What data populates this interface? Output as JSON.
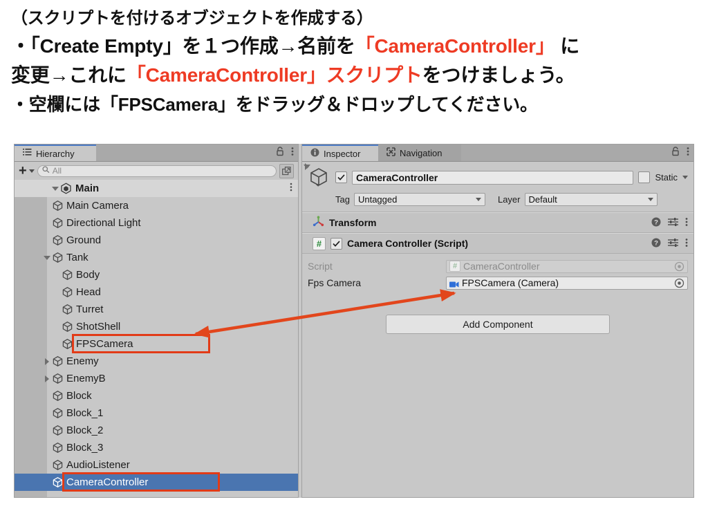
{
  "instructions": {
    "line1": "（スクリプトを付けるオブジェクトを作成する）",
    "line2_a": "・「Create Empty」を１つ作成→名前を",
    "line2_red": "「CameraController」",
    "line2_b": " に",
    "line3_a": "変更→これに",
    "line3_red": "「CameraController」スクリプト",
    "line3_b": "をつけましょう。",
    "line4": "・空欄には「FPSCamera」をドラッグ＆ドロップしてください。",
    "highlight_color": "#ee3b24"
  },
  "hierarchy": {
    "tab_label": "Hierarchy",
    "add_label": "+",
    "search_placeholder": "All",
    "search_value": "",
    "scene": {
      "name": "Main",
      "expanded": true
    },
    "items": [
      {
        "label": "Main Camera",
        "depth": 2,
        "twisty": "none",
        "selected": false,
        "boxed": false
      },
      {
        "label": "Directional Light",
        "depth": 2,
        "twisty": "none",
        "selected": false,
        "boxed": false
      },
      {
        "label": "Ground",
        "depth": 2,
        "twisty": "none",
        "selected": false,
        "boxed": false
      },
      {
        "label": "Tank",
        "depth": 2,
        "twisty": "down",
        "selected": false,
        "boxed": false
      },
      {
        "label": "Body",
        "depth": 3,
        "twisty": "none",
        "selected": false,
        "boxed": false
      },
      {
        "label": "Head",
        "depth": 3,
        "twisty": "none",
        "selected": false,
        "boxed": false
      },
      {
        "label": "Turret",
        "depth": 3,
        "twisty": "none",
        "selected": false,
        "boxed": false
      },
      {
        "label": "ShotShell",
        "depth": 3,
        "twisty": "none",
        "selected": false,
        "boxed": false
      },
      {
        "label": "FPSCamera",
        "depth": 3,
        "twisty": "none",
        "selected": false,
        "boxed": true
      },
      {
        "label": "Enemy",
        "depth": 2,
        "twisty": "right",
        "selected": false,
        "boxed": false
      },
      {
        "label": "EnemyB",
        "depth": 2,
        "twisty": "right",
        "selected": false,
        "boxed": false
      },
      {
        "label": "Block",
        "depth": 2,
        "twisty": "none",
        "selected": false,
        "boxed": false
      },
      {
        "label": "Block_1",
        "depth": 2,
        "twisty": "none",
        "selected": false,
        "boxed": false
      },
      {
        "label": "Block_2",
        "depth": 2,
        "twisty": "none",
        "selected": false,
        "boxed": false
      },
      {
        "label": "Block_3",
        "depth": 2,
        "twisty": "none",
        "selected": false,
        "boxed": false
      },
      {
        "label": "AudioListener",
        "depth": 2,
        "twisty": "none",
        "selected": false,
        "boxed": false
      },
      {
        "label": "CameraController",
        "depth": 2,
        "twisty": "none",
        "selected": true,
        "boxed": true
      }
    ],
    "selection_color": "#4a75b0"
  },
  "inspector": {
    "tabs": [
      {
        "label": "Inspector",
        "icon": "info-icon",
        "active": true
      },
      {
        "label": "Navigation",
        "icon": "navigation-icon",
        "active": false
      }
    ],
    "object": {
      "enabled_checkmark": "✔",
      "name": "CameraController",
      "static_label": "Static",
      "static_checked": false,
      "tag_label": "Tag",
      "tag_value": "Untagged",
      "layer_label": "Layer",
      "layer_value": "Default"
    },
    "components": [
      {
        "title": "Transform",
        "expanded": false,
        "icon": "transform-gizmo-icon",
        "has_enable_checkbox": false
      },
      {
        "title": "Camera Controller (Script)",
        "expanded": true,
        "icon": "script-hash-icon",
        "has_enable_checkbox": true,
        "enabled_checkmark": "✔"
      }
    ],
    "properties": [
      {
        "label": "Script",
        "value": "CameraController",
        "icon": "script-hash-icon",
        "disabled": true
      },
      {
        "label": "Fps Camera",
        "value": "FPSCamera (Camera)",
        "icon": "camera-icon",
        "disabled": false
      }
    ],
    "add_component_label": "Add Component"
  },
  "annotations": {
    "box_color": "#e23b17",
    "arrow_color": "#e2461c",
    "arrow_from": "FPSCamera hierarchy item",
    "arrow_to": "Fps Camera object field"
  }
}
